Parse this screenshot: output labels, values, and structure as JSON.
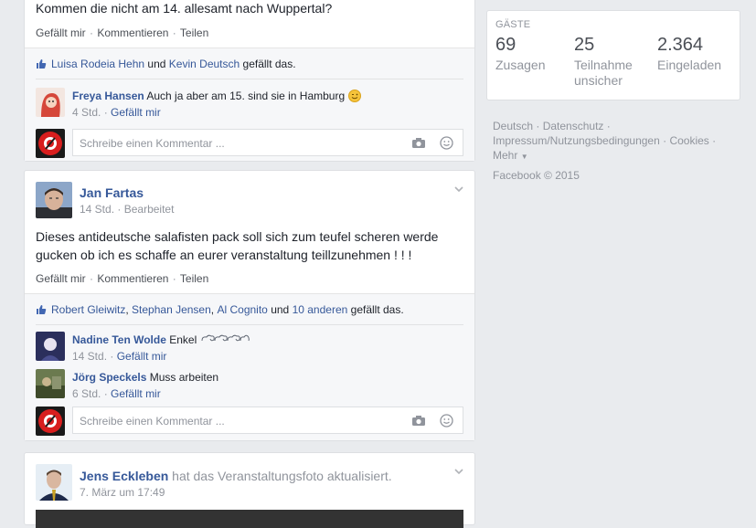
{
  "post1": {
    "text_tail": "Kommen die nicht am 14. allesamt nach Wuppertal?",
    "actions": [
      "Gefällt mir",
      "Kommentieren",
      "Teilen"
    ],
    "likes": {
      "names": [
        "Luisa Rodeia Hehn",
        "Kevin Deutsch"
      ],
      "conj": "und",
      "suffix": "gefällt das."
    },
    "comments": [
      {
        "author": "Freya Hansen",
        "text": "Auch ja aber am 15. sind sie in Hamburg",
        "time": "4 Std.",
        "like": "Gefällt mir"
      }
    ],
    "reply_placeholder": "Schreibe einen Kommentar ..."
  },
  "post2": {
    "author": "Jan Fartas",
    "time": "14 Std.",
    "edited": "Bearbeitet",
    "text": "Dieses antideutsche salafisten pack soll sich zum teufel scheren werde gucken ob ich es schaffe an eurer veranstaltung teillzunehmen ! ! !",
    "actions": [
      "Gefällt mir",
      "Kommentieren",
      "Teilen"
    ],
    "likes": {
      "names": [
        "Robert Gleiwitz",
        "Stephan Jensen",
        "Al Cognito",
        "10 anderen"
      ],
      "sep": ",",
      "conj": "und",
      "suffix": "gefällt das."
    },
    "comments": [
      {
        "author": "Nadine Ten Wolde",
        "text": "Enkel",
        "time": "14 Std.",
        "like": "Gefällt mir"
      },
      {
        "author": "Jörg Speckels",
        "text": "Muss arbeiten",
        "time": "6 Std.",
        "like": "Gefällt mir"
      }
    ],
    "reply_placeholder": "Schreibe einen Kommentar ..."
  },
  "post3": {
    "author": "Jens Eckleben",
    "action": "hat das Veranstaltungsfoto aktualisiert.",
    "time": "7. März um 17:49"
  },
  "guests": {
    "title": "GÄSTE",
    "stats": [
      {
        "value": "69",
        "label": "Zusagen"
      },
      {
        "value": "25",
        "label": "Teilnahme unsicher"
      },
      {
        "value": "2.364",
        "label": "Eingeladen"
      }
    ]
  },
  "footer": {
    "links": [
      "Deutsch",
      "Datenschutz",
      "Impressum/Nutzungsbedingungen",
      "Cookies",
      "Mehr"
    ],
    "copyright": "Facebook © 2015"
  },
  "colors": {
    "link": "#365899",
    "bg": "#e9ebee",
    "meta": "#90949c"
  }
}
